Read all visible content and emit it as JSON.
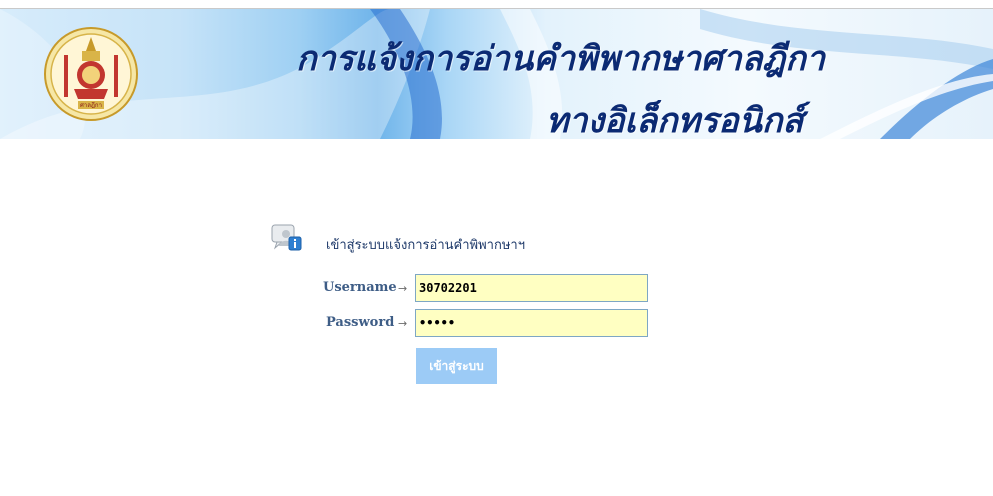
{
  "header": {
    "title_line1": "การแจ้งการอ่านคำพิพากษาศาลฎีกา",
    "title_line2": "ทางอิเล็กทรอนิกส์",
    "emblem_caption": "ศาลฎีกา"
  },
  "login": {
    "heading": "เข้าสู่ระบบแจ้งการอ่านคำพิพากษาฯ",
    "username_label": "Username",
    "username_value": "30702201",
    "password_label": "Password",
    "password_value": "•••••",
    "arrow_glyph": "→",
    "submit_label": "เข้าสู่ระบบ"
  },
  "colors": {
    "title": "#0b2a73",
    "field_bg": "#ffffc2",
    "button_bg": "#9ccbf6",
    "label": "#3e5d86"
  }
}
